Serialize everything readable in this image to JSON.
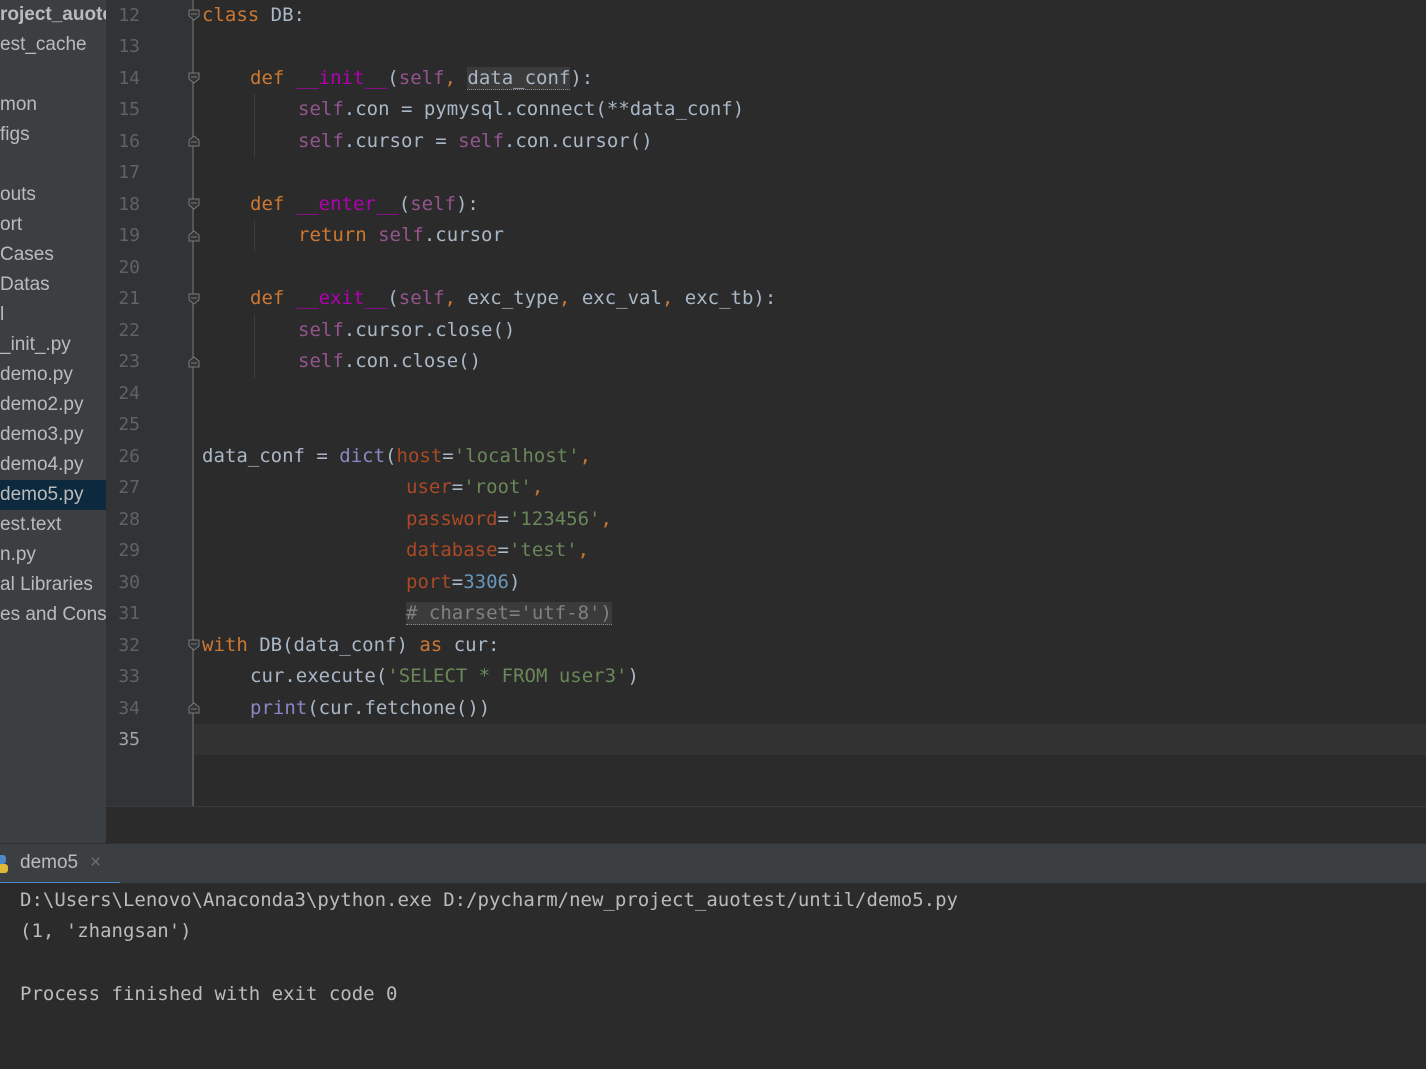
{
  "project_tree": {
    "items": [
      {
        "label": "roject_auote",
        "bold": true
      },
      {
        "label": "est_cache"
      },
      {
        "label": "mon"
      },
      {
        "label": "figs"
      },
      {
        "label": "outs"
      },
      {
        "label": "ort"
      },
      {
        "label": "Cases"
      },
      {
        "label": "Datas"
      },
      {
        "label": "l"
      },
      {
        "label": "_init_.py"
      },
      {
        "label": "demo.py"
      },
      {
        "label": "demo2.py"
      },
      {
        "label": "demo3.py"
      },
      {
        "label": "demo4.py"
      },
      {
        "label": "demo5.py",
        "selected": true
      },
      {
        "label": "est.text"
      },
      {
        "label": "n.py"
      },
      {
        "label": "al Libraries"
      },
      {
        "label": "es and Cons"
      }
    ]
  },
  "editor": {
    "line_numbers": [
      "12",
      "13",
      "14",
      "15",
      "16",
      "17",
      "18",
      "19",
      "20",
      "21",
      "22",
      "23",
      "24",
      "25",
      "26",
      "27",
      "28",
      "29",
      "30",
      "31",
      "32",
      "33",
      "34",
      "35"
    ],
    "current_line": "35",
    "code": {
      "l12": {
        "kw_class": "class",
        "name": " DB:"
      },
      "l14": {
        "kw_def": "def",
        "fn": "__init__",
        "open": "(",
        "self": "self",
        "comma": ", ",
        "param": "data_conf",
        "close": "):"
      },
      "l15": {
        "self": "self",
        "rest": ".con = pymysql.connect(**data_conf)"
      },
      "l16": {
        "self1": "self",
        "mid": ".cursor = ",
        "self2": "self",
        "rest": ".con.cursor()"
      },
      "l18": {
        "kw_def": "def",
        "fn": "__enter__",
        "open": "(",
        "self": "self",
        "close": "):"
      },
      "l19": {
        "kw_return": "return",
        "self": "self",
        "rest": ".cursor"
      },
      "l21": {
        "kw_def": "def",
        "fn": "__exit__",
        "open": "(",
        "self": "self",
        "c1": ", ",
        "a1": "exc_type",
        "c2": ", ",
        "a2": "exc_val",
        "c3": ", ",
        "a3": "exc_tb",
        "close": "):"
      },
      "l22": {
        "self": "self",
        "rest": ".cursor.close()"
      },
      "l23": {
        "self": "self",
        "rest": ".con.close()"
      },
      "l26": {
        "lead": "data_conf = ",
        "builtin": "dict",
        "open": "(",
        "param": "host",
        "eq": "=",
        "str": "'localhost'",
        "comma": ","
      },
      "l27": {
        "param": "user",
        "eq": "=",
        "str": "'root'",
        "comma": ","
      },
      "l28": {
        "param": "password",
        "eq": "=",
        "str": "'123456'",
        "comma": ","
      },
      "l29": {
        "param": "database",
        "eq": "=",
        "str": "'test'",
        "comma": ","
      },
      "l30": {
        "param": "port",
        "eq": "=",
        "num": "3306",
        "close": ")"
      },
      "l31": {
        "comment": "# charset='utf-8')"
      },
      "l32": {
        "kw_with": "with",
        "mid": " DB(data_conf) ",
        "kw_as": "as",
        "rest": " cur:"
      },
      "l33": {
        "lead": "cur.execute(",
        "str": "'SELECT * FROM user3'",
        "close": ")"
      },
      "l34": {
        "builtin": "print",
        "rest": "(cur.fetchone())"
      }
    }
  },
  "run_panel": {
    "tab_label": "demo5",
    "close_glyph": "×",
    "icon": "python-icon",
    "output": [
      "D:\\Users\\Lenovo\\Anaconda3\\python.exe D:/pycharm/new_project_auotest/until/demo5.py",
      "(1, 'zhangsan')",
      "",
      "Process finished with exit code 0"
    ]
  },
  "colors": {
    "editor_bg": "#2b2b2b",
    "sidebar_bg": "#3c3f41",
    "keyword": "#cc7832",
    "self": "#94558d",
    "magic": "#b200b2",
    "string": "#6a8759",
    "number": "#6897bb",
    "param": "#aa4926",
    "selection": "#0d293e",
    "tab_underline": "#4a88c7"
  }
}
